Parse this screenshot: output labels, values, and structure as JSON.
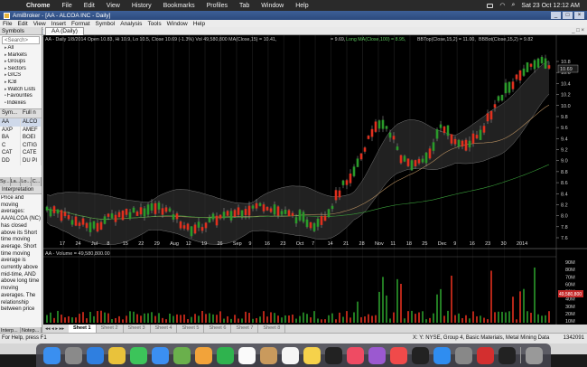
{
  "menubar": {
    "app": "Chrome",
    "items": [
      "File",
      "Edit",
      "View",
      "History",
      "Bookmarks",
      "Profiles",
      "Tab",
      "Window",
      "Help"
    ],
    "datetime": "Sat 23 Oct  12:12 AM"
  },
  "window": {
    "title": "AmiBroker - [AA - ALCOA INC - Daily]",
    "menu": [
      "File",
      "Edit",
      "View",
      "Insert",
      "Format",
      "Symbol",
      "Analysis",
      "Tools",
      "Window",
      "Help"
    ],
    "symbol_box": "AA"
  },
  "symbols_panel": {
    "title": "Symbols",
    "search_placeholder": "<Search>",
    "tree": [
      "All",
      "Markets",
      "Groups",
      "Sectors",
      "GICS",
      "ICB",
      "Watch Lists",
      "Favourites",
      "Indexes"
    ],
    "col1": "Sym...",
    "col2": "Full n",
    "rows": [
      {
        "sym": "AA",
        "name": "ALCO"
      },
      {
        "sym": "AXP",
        "name": "AMEF"
      },
      {
        "sym": "BA",
        "name": "BOEI"
      },
      {
        "sym": "C",
        "name": "CITIG"
      },
      {
        "sym": "CAT",
        "name": "CATE"
      },
      {
        "sym": "DD",
        "name": "DU PI"
      }
    ],
    "tabs": [
      "Sy...",
      "La...",
      "Lo...",
      "C..."
    ]
  },
  "interpretation": {
    "title": "Interpretation",
    "text": "Price and moving averages: AA/ALCOA (NC) has closed above its Short time moving average. Short time moving average is currently above mid-time, AND above long time moving averages. The relationship between price",
    "tabs": [
      "Interp...",
      "Notep..."
    ]
  },
  "chart": {
    "tab": "AA (Daily)",
    "header_line": "AA - Daily  1/8/2014 Open 10.83, Hi 10.9, Lo 10.5, Close 10.69 (-1.3%) Vol 49,580,800  MA(Close,15) = 10.41,",
    "header_ma2": "= 9.69,",
    "header_ma3": "Long MA(Close,100) = 8.95,",
    "header_bb": "BBTop(Close,15,2) = 11.00,",
    "header_bb2": "BBBot(Close,15,2) = 9.82",
    "price_label": "10.69",
    "volume_header": "AA - Volume = 49,580,800.00",
    "volume_label": "49,580,800",
    "price_ticks": [
      "10.8",
      "10.6",
      "10.4",
      "10.2",
      "10.0",
      "9.8",
      "9.6",
      "9.4",
      "9.2",
      "9.0",
      "8.8",
      "8.6",
      "8.4",
      "8.2",
      "8.0",
      "7.8",
      "7.6"
    ],
    "volume_ticks": [
      "90M",
      "80M",
      "70M",
      "60M",
      "50M",
      "40M",
      "30M",
      "20M",
      "10M"
    ],
    "date_labels": [
      "17",
      "24",
      "Jul",
      "8",
      "15",
      "22",
      "29",
      "Aug",
      "12",
      "19",
      "26",
      "Sep",
      "9",
      "16",
      "23",
      "Oct",
      "7",
      "14",
      "21",
      "28",
      "Nov",
      "11",
      "18",
      "25",
      "Dec",
      "9",
      "16",
      "23",
      "30",
      "2014"
    ],
    "colors": {
      "up": "#2a9a2a",
      "down": "#e0301e",
      "bg": "#000000"
    }
  },
  "sheets": [
    "Sheet 1",
    "Sheet 2",
    "Sheet 3",
    "Sheet 4",
    "Sheet 5",
    "Sheet 6",
    "Sheet 7",
    "Sheet 8"
  ],
  "status": {
    "help": "For Help, press F1",
    "info": "X: Y: NYSE, Group 4, Basic Materials, Metal Mining Data",
    "right": "1342091"
  },
  "dock": [
    "finder",
    "launchpad",
    "safari",
    "chrome",
    "messages",
    "mail",
    "maps",
    "photos",
    "facetime",
    "calendar",
    "contacts",
    "reminders",
    "notes",
    "tv",
    "music",
    "podcasts",
    "news",
    "stocks",
    "app-store",
    "preferences",
    "acrobat",
    "terminal",
    "trash"
  ]
}
